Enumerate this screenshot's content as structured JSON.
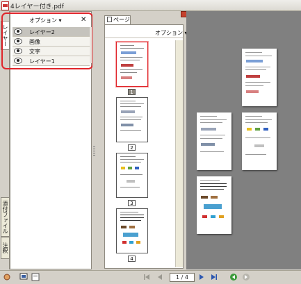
{
  "window": {
    "title": "4レイヤー付き.pdf"
  },
  "left_tabs": {
    "layers": "レイヤー",
    "attachments": "添付ファイル",
    "comments": "注釈"
  },
  "layers_panel": {
    "options_label": "オプション ▾",
    "close_label": "✕",
    "items": [
      {
        "label": "レイヤー2",
        "selected": true
      },
      {
        "label": "画像",
        "selected": false
      },
      {
        "label": "文字",
        "selected": false
      },
      {
        "label": "レイヤー1",
        "selected": false
      }
    ]
  },
  "pages_panel": {
    "tab_label": "ページ",
    "options_label": "オプション ▾",
    "thumbnails": [
      {
        "label": "1",
        "selected": true
      },
      {
        "label": "2",
        "selected": false
      },
      {
        "label": "3",
        "selected": false
      },
      {
        "label": "4",
        "selected": false
      }
    ]
  },
  "statusbar": {
    "page_indicator": "1 / 4"
  },
  "colors": {
    "highlight": "#e0242a",
    "doc_background": "#808080"
  }
}
